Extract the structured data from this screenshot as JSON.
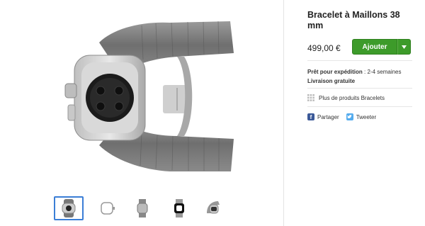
{
  "product": {
    "title": "Bracelet à Maillons 38 mm",
    "price": "499,00 €",
    "add_label": "Ajouter",
    "shipping_label": "Prêt pour expédition",
    "shipping_value": ": 2-4 semaines",
    "delivery": "Livraison gratuite",
    "more_products": "Plus de produits Bracelets",
    "share": "Partager",
    "tweet": "Tweeter"
  },
  "colors": {
    "add_button": "#3d9b2a",
    "facebook": "#3b5998",
    "twitter": "#55acee",
    "selected_thumb_border": "#3b7ed6"
  },
  "thumbnails": [
    {
      "icon": "watch-link-bracelet-back-icon",
      "selected": true
    },
    {
      "icon": "watch-face-outline-icon",
      "selected": false
    },
    {
      "icon": "watch-side-icon",
      "selected": false
    },
    {
      "icon": "watch-front-display-icon",
      "selected": false
    },
    {
      "icon": "watch-angled-icon",
      "selected": false
    }
  ]
}
